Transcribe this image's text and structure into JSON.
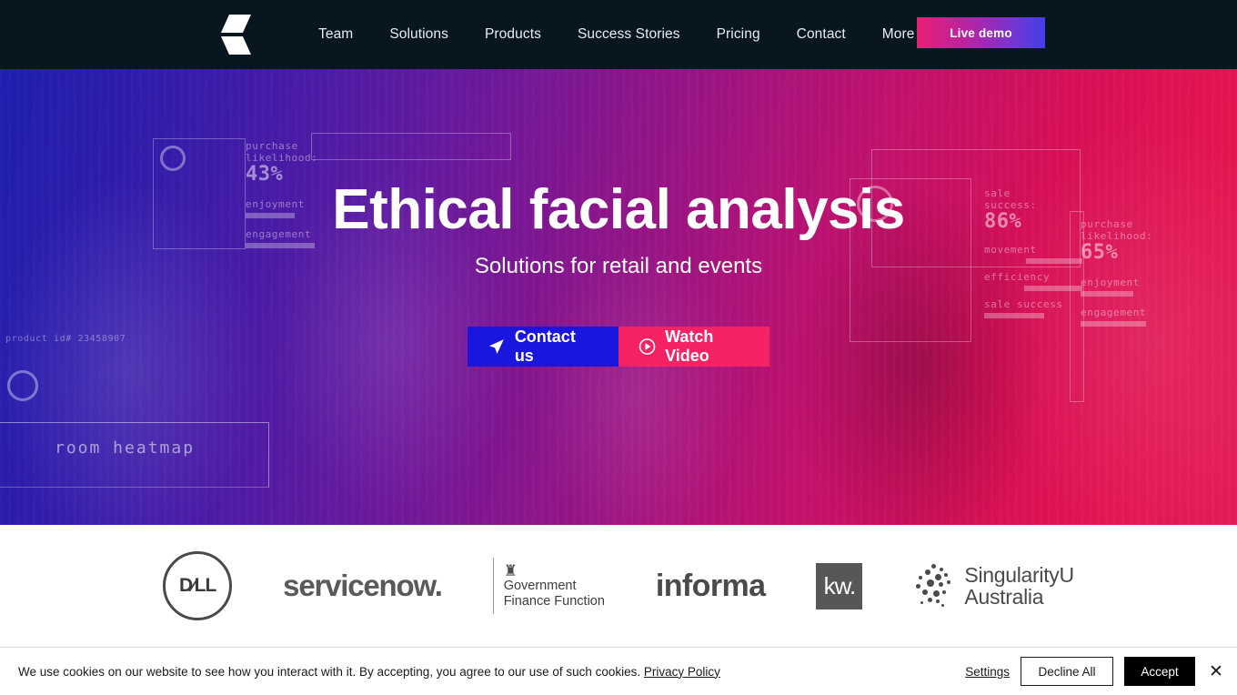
{
  "header": {
    "logo_icon": "brand-s-logo",
    "nav_items": [
      {
        "label": "Team"
      },
      {
        "label": "Solutions"
      },
      {
        "label": "Products"
      },
      {
        "label": "Success Stories"
      },
      {
        "label": "Pricing"
      },
      {
        "label": "Contact"
      },
      {
        "label": "More"
      }
    ],
    "cta": {
      "label": "Live demo",
      "gradient_start": "#e81f74",
      "gradient_end": "#4040e8"
    },
    "background_color": "#08161f"
  },
  "hero": {
    "title": "Ethical facial analysis",
    "subtitle": "Solutions for retail and events",
    "buttons": [
      {
        "label": "Contact us",
        "icon": "send-icon",
        "color": "#1a16dd"
      },
      {
        "label": "Watch Video",
        "icon": "play-circle-icon",
        "color": "#f52365"
      }
    ],
    "overlays": {
      "left_panel": {
        "metric_label_line1": "purchase",
        "metric_label_line2": "likelihood:",
        "metric_value": "43%",
        "bar1_label": "enjoyment",
        "bar2_label": "engagement"
      },
      "right_panel": {
        "metric_label_line1": "sale",
        "metric_label_line2": "success:",
        "metric_value": "86%",
        "bar1_label": "movement",
        "bar2_label": "efficiency",
        "bar3_label": "sale success"
      },
      "far_right_panel": {
        "metric_label_line1": "purchase",
        "metric_label_line2": "likelihood:",
        "metric_value": "65%",
        "bar1_label": "enjoyment",
        "bar2_label": "engagement"
      },
      "heatmap_label": "room heatmap",
      "product_id": "product id# 23458907"
    }
  },
  "logo_strip": {
    "logos": [
      {
        "name": "dell",
        "text": "D⁄LL"
      },
      {
        "name": "servicenow",
        "text": "servicenow."
      },
      {
        "name": "government-finance-function",
        "crest": "♜",
        "line1": "Government",
        "line2": "Finance Function"
      },
      {
        "name": "informa",
        "text": "informa"
      },
      {
        "name": "keller-williams",
        "text": "kw."
      },
      {
        "name": "singularityu-australia",
        "line1": "SingularityU",
        "line2": "Australia"
      }
    ]
  },
  "cookie_banner": {
    "message": "We use cookies on our website to see how you interact with it. By accepting, you agree to our use of such cookies.",
    "privacy_link": "Privacy Policy",
    "settings_label": "Settings",
    "decline_label": "Decline All",
    "accept_label": "Accept",
    "close_icon": "close-icon"
  }
}
